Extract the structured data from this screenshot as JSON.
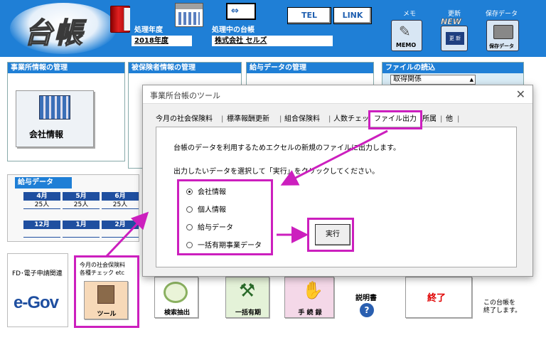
{
  "header": {
    "logo_text": "台帳",
    "fiscal_year_label": "処理年度",
    "fiscal_year_value": "2018年度",
    "ledger_label": "処理中の台帳",
    "company_value": "株式会社 セルズ",
    "buttons": {
      "tel": "TEL",
      "link": "LINK"
    },
    "memo": {
      "caption": "メモ",
      "label": "MEMO"
    },
    "update": {
      "caption": "更新",
      "new": "NEW",
      "icon_text": "更 新"
    },
    "save": {
      "caption": "保存データ",
      "label": "保存データ"
    }
  },
  "panels": {
    "office": {
      "title": "事業所情報の管理",
      "button": "会社情報"
    },
    "insured": {
      "title": "被保険者情報の管理"
    },
    "salary": {
      "title": "給与データの管理"
    },
    "file_read": {
      "title": "ファイルの読込",
      "select_value": "取得関係"
    }
  },
  "salary_data": {
    "title": "給与データ",
    "months_top": [
      "4月",
      "5月",
      "6月"
    ],
    "counts_top": [
      "25人",
      "25人",
      "25人"
    ],
    "months_bottom": [
      "12月",
      "1月",
      "2月"
    ]
  },
  "bottom": {
    "efiling_label": "FD･電子申請関連",
    "egov_text": "e-Gov",
    "tool_desc_line1": "今月の社会保険料",
    "tool_desc_line2": "各種チェック etc",
    "tool_label": "ツール",
    "search_label": "検索抽出",
    "ikkatsu_label": "一括有期",
    "procedure_label": "手 続 録",
    "manual_label": "説明書",
    "exit_label": "終了",
    "exit_desc_line1": "この台帳を",
    "exit_desc_line2": "終了します。"
  },
  "dialog": {
    "title": "事業所台帳のツール",
    "tabs": [
      "今月の社会保険料",
      "標準報酬更新",
      "組合保険料",
      "人数チェック",
      "ファイル出力",
      "所属",
      "他"
    ],
    "active_tab": "ファイル出力",
    "description": "台帳のデータを利用するためエクセルの新規のファイルに出力します。",
    "instruction": "出力したいデータを選択して「実行」をクリックしてください。",
    "options": [
      "会社情報",
      "個人情報",
      "給与データ",
      "一括有期事業データ"
    ],
    "selected_option": "会社情報",
    "run_button": "実行",
    "close_symbol": "✕"
  },
  "colors": {
    "header_blue": "#1f7fd6",
    "highlight": "#cc1fbe",
    "exit_red": "#e00000"
  }
}
